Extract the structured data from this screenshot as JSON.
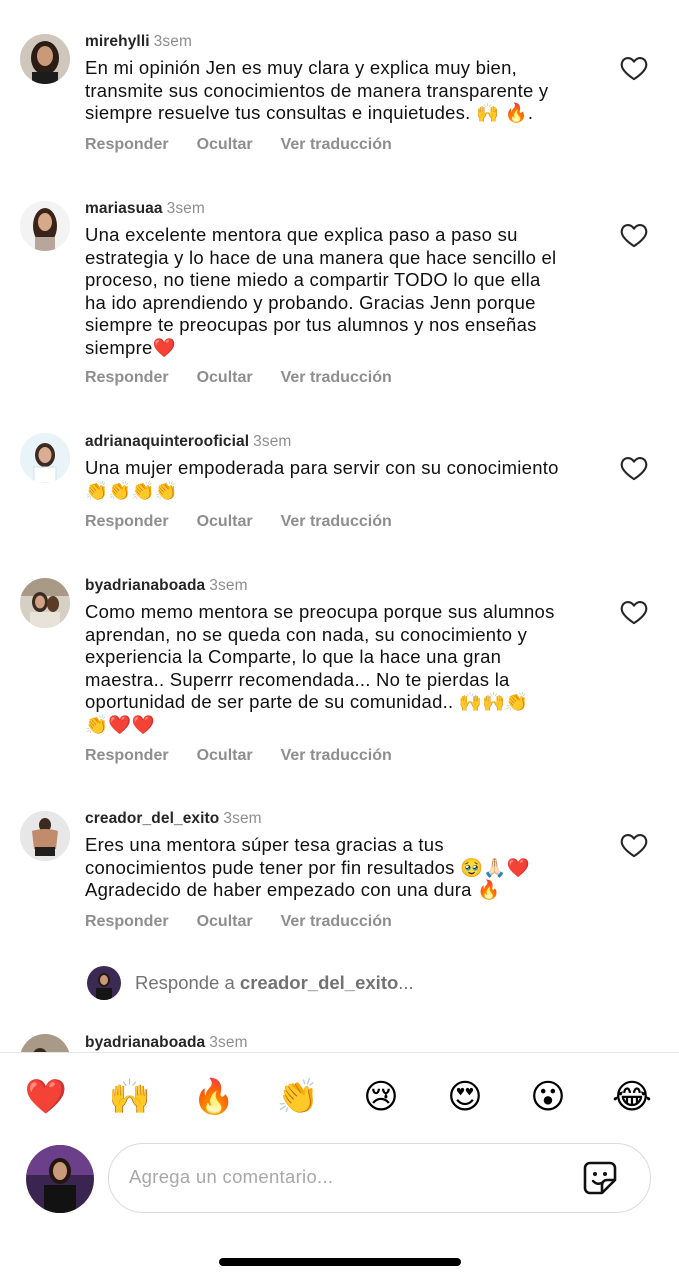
{
  "comments": [
    {
      "user": "mirehylli",
      "time": "3sem",
      "text": "En mi opinión Jen es muy clara y explica muy bien,\ntransmite sus conocimientos de manera transparente y\nsiempre resuelve tus consultas e inquietudes. 🙌 🔥.",
      "actions": [
        "Responder",
        "Ocultar",
        "Ver traducción"
      ]
    },
    {
      "user": "mariasuaa",
      "time": "3sem",
      "text": "Una excelente mentora que explica paso a paso su\nestrategia y lo hace de una manera que hace sencillo el\nproceso, no tiene miedo a compartir TODO lo que ella\nha ido aprendiendo y probando. Gracias Jenn porque\nsiempre te preocupas por tus alumnos y nos enseñas\nsiempre❤️",
      "actions": [
        "Responder",
        "Ocultar",
        "Ver traducción"
      ]
    },
    {
      "user": "adrianaquinterooficial",
      "time": "3sem",
      "text": "Una mujer empoderada para servir con su conocimiento\n👏👏👏👏",
      "actions": [
        "Responder",
        "Ocultar",
        "Ver traducción"
      ]
    },
    {
      "user": "byadrianaboada",
      "time": "3sem",
      "text": "Como memo mentora se preocupa porque sus alumnos\naprendan, no se queda  con nada, su conocimiento y\nexperiencia la Comparte, lo que la hace una gran\nmaestra.. Superrr recomendada... No te pierdas la\noportunidad de ser parte de su comunidad.. 🙌🙌👏\n👏❤️❤️",
      "actions": [
        "Responder",
        "Ocultar",
        "Ver traducción"
      ]
    },
    {
      "user": "creador_del_exito",
      "time": "3sem",
      "text": "Eres una mentora súper tesa gracias a tus\nconocimientos pude tener por fin resultados 🥹🙏🏻❤️\nAgradecido de haber empezado con una dura 🔥",
      "actions": [
        "Responder",
        "Ocultar",
        "Ver traducción"
      ]
    }
  ],
  "reply_prompt": {
    "prefix": "Responde a ",
    "user": "creador_del_exito",
    "suffix": "..."
  },
  "next_comment": {
    "user": "byadrianaboada",
    "time": "3sem"
  },
  "reactions": [
    "❤️",
    "🙌",
    "🔥",
    "👏",
    "😢",
    "😍",
    "😮",
    "😂"
  ],
  "composer": {
    "placeholder": "Agrega un comentario..."
  },
  "icons": {
    "like": "heart-outline-icon",
    "sticker": "sticker-icon"
  },
  "colors": {
    "muted": "#8e8e8e",
    "text": "#111111",
    "border": "#dbdbdb"
  }
}
